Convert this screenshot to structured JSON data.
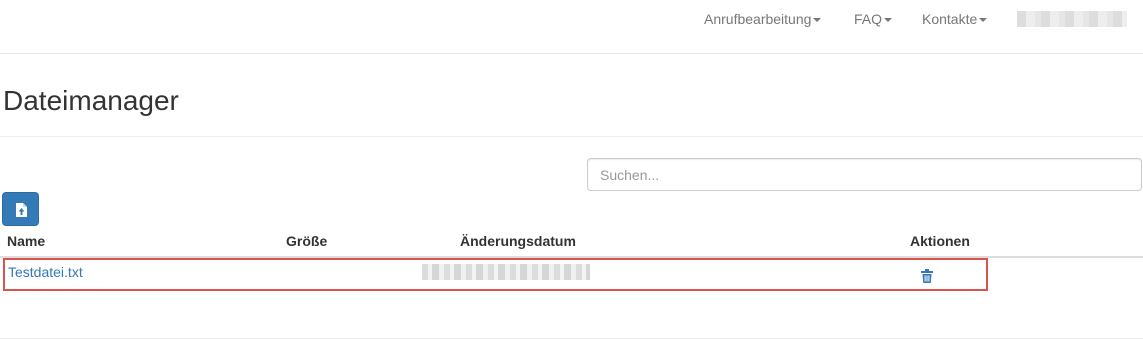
{
  "nav": {
    "items": [
      {
        "label": "Anrufbearbeitung"
      },
      {
        "label": "FAQ"
      },
      {
        "label": "Kontakte"
      }
    ]
  },
  "page": {
    "title": "Dateimanager"
  },
  "search": {
    "placeholder": "Suchen...",
    "value": ""
  },
  "upload": {
    "icon": "file-upload-icon"
  },
  "table": {
    "headers": [
      "Name",
      "Größe",
      "Änderungsdatum",
      "Aktionen"
    ],
    "rows": [
      {
        "name": "Testdatei.txt",
        "size": "",
        "action_icon": "trash-icon"
      }
    ]
  },
  "colors": {
    "primary": "#337ab7",
    "highlight": "#d9534f",
    "nav_text": "#777777"
  }
}
